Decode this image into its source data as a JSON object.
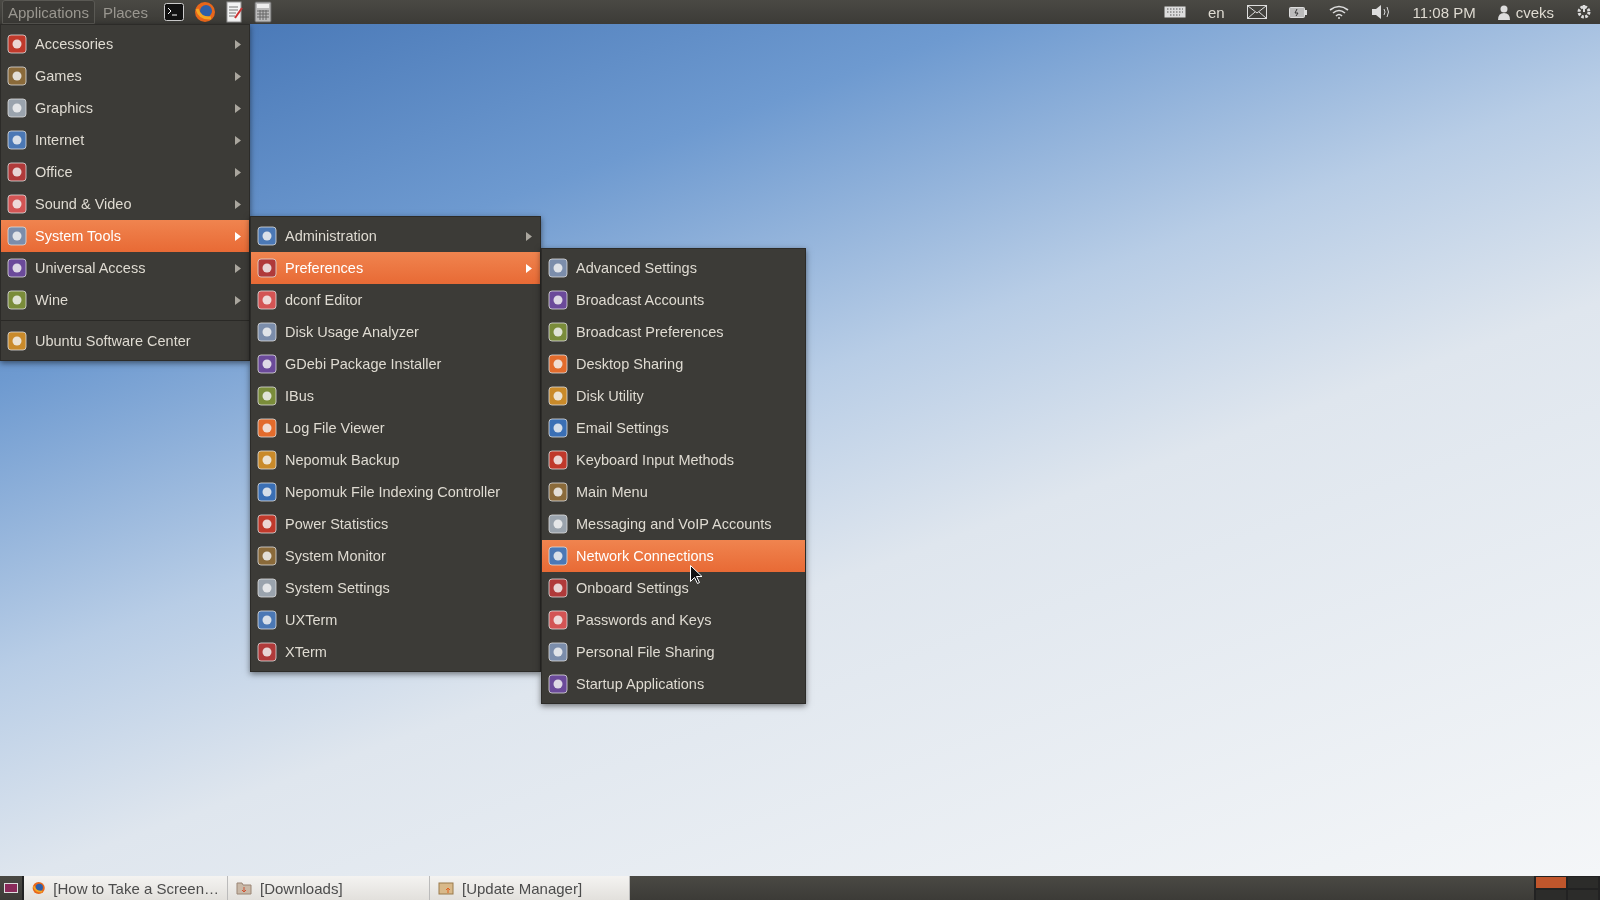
{
  "top_panel": {
    "menus": [
      {
        "label": "Applications",
        "selected": true
      },
      {
        "label": "Places",
        "selected": false
      }
    ],
    "launchers": [
      {
        "kind": "terminal"
      },
      {
        "kind": "browser"
      },
      {
        "kind": "editor"
      },
      {
        "kind": "calculator"
      }
    ],
    "keyboard_layout": "en",
    "clock": "11:08 PM",
    "user": "cveks"
  },
  "menus": [
    {
      "items": [
        {
          "kind": "submenu",
          "label": "Accessories",
          "selected": false
        },
        {
          "kind": "submenu",
          "label": "Games",
          "selected": false
        },
        {
          "kind": "submenu",
          "label": "Graphics",
          "selected": false
        },
        {
          "kind": "submenu",
          "label": "Internet",
          "selected": false
        },
        {
          "kind": "submenu",
          "label": "Office",
          "selected": false
        },
        {
          "kind": "submenu",
          "label": "Sound & Video",
          "selected": false
        },
        {
          "kind": "submenu",
          "label": "System Tools",
          "selected": true
        },
        {
          "kind": "submenu",
          "label": "Universal Access",
          "selected": false
        },
        {
          "kind": "submenu",
          "label": "Wine",
          "selected": false
        },
        {
          "kind": "separator"
        },
        {
          "kind": "item",
          "label": "Ubuntu Software Center",
          "selected": false
        }
      ]
    },
    {
      "items": [
        {
          "kind": "submenu",
          "label": "Administration",
          "selected": false
        },
        {
          "kind": "submenu",
          "label": "Preferences",
          "selected": true
        },
        {
          "kind": "item",
          "label": "dconf Editor",
          "selected": false
        },
        {
          "kind": "item",
          "label": "Disk Usage Analyzer",
          "selected": false
        },
        {
          "kind": "item",
          "label": "GDebi Package Installer",
          "selected": false
        },
        {
          "kind": "item",
          "label": "IBus",
          "selected": false
        },
        {
          "kind": "item",
          "label": "Log File Viewer",
          "selected": false
        },
        {
          "kind": "item",
          "label": "Nepomuk Backup",
          "selected": false
        },
        {
          "kind": "item",
          "label": "Nepomuk File Indexing Controller",
          "selected": false
        },
        {
          "kind": "item",
          "label": "Power Statistics",
          "selected": false
        },
        {
          "kind": "item",
          "label": "System Monitor",
          "selected": false
        },
        {
          "kind": "item",
          "label": "System Settings",
          "selected": false
        },
        {
          "kind": "item",
          "label": "UXTerm",
          "selected": false
        },
        {
          "kind": "item",
          "label": "XTerm",
          "selected": false
        }
      ]
    },
    {
      "items": [
        {
          "kind": "item",
          "label": "Advanced Settings",
          "selected": false
        },
        {
          "kind": "item",
          "label": "Broadcast Accounts",
          "selected": false
        },
        {
          "kind": "item",
          "label": "Broadcast Preferences",
          "selected": false
        },
        {
          "kind": "item",
          "label": "Desktop Sharing",
          "selected": false
        },
        {
          "kind": "item",
          "label": "Disk Utility",
          "selected": false
        },
        {
          "kind": "item",
          "label": "Email Settings",
          "selected": false
        },
        {
          "kind": "item",
          "label": "Keyboard Input Methods",
          "selected": false
        },
        {
          "kind": "item",
          "label": "Main Menu",
          "selected": false
        },
        {
          "kind": "item",
          "label": "Messaging and VoIP Accounts",
          "selected": false
        },
        {
          "kind": "item",
          "label": "Network Connections",
          "selected": true
        },
        {
          "kind": "item",
          "label": "Onboard Settings",
          "selected": false
        },
        {
          "kind": "item",
          "label": "Passwords and Keys",
          "selected": false
        },
        {
          "kind": "item",
          "label": "Personal File Sharing",
          "selected": false
        },
        {
          "kind": "item",
          "label": "Startup Applications",
          "selected": false
        }
      ]
    }
  ],
  "taskbar": {
    "windows": [
      {
        "kind": "browser",
        "label": "[How to Take a Screen…"
      },
      {
        "kind": "folder",
        "label": "[Downloads]"
      },
      {
        "kind": "updater",
        "label": "[Update Manager]"
      }
    ]
  },
  "workspaces": [
    {
      "selected": true
    },
    {
      "selected": false
    },
    {
      "selected": false
    },
    {
      "selected": false
    }
  ]
}
